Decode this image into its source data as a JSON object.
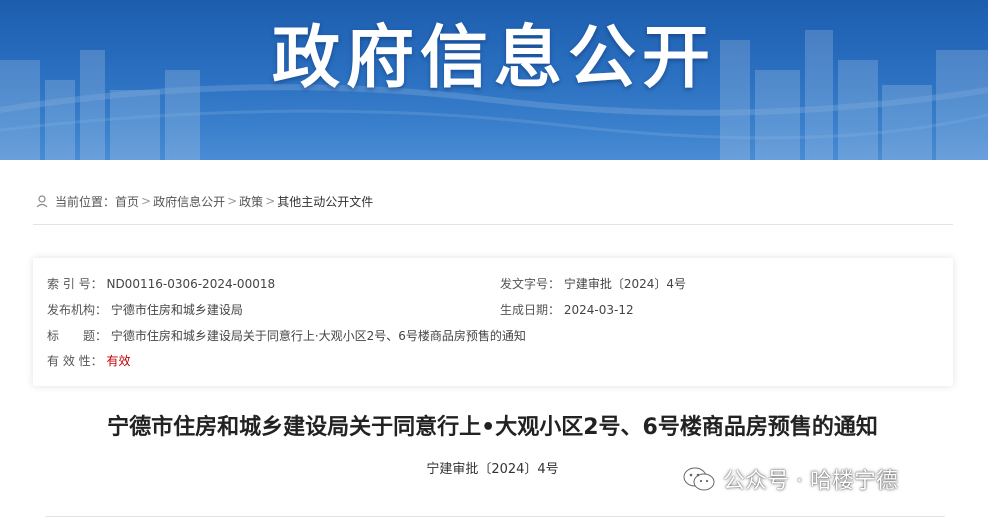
{
  "banner": {
    "title": "政府信息公开"
  },
  "breadcrumb": {
    "prefix": "当前位置：",
    "items": [
      "首页",
      "政府信息公开",
      "政策",
      "其他主动公开文件"
    ],
    "separator": ">"
  },
  "info": {
    "index_label": "索 引 号：",
    "index_value": "ND00116-0306-2024-00018",
    "doc_no_label": "发文字号：",
    "doc_no_value": "宁建审批〔2024〕4号",
    "publisher_label": "发布机构：",
    "publisher_value": "宁德市住房和城乡建设局",
    "date_label": "生成日期：",
    "date_value": "2024-03-12",
    "title_label": "标　　题：",
    "title_value": "宁德市住房和城乡建设局关于同意行上·大观小区2号、6号楼商品房预售的通知",
    "validity_label": "有 效 性：",
    "validity_value": "有效",
    "validity_color": "#c00000"
  },
  "document": {
    "title": "宁德市住房和城乡建设局关于同意行上•大观小区2号、6号楼商品房预售的通知",
    "number": "宁建审批〔2024〕4号"
  },
  "watermark": {
    "text": "公众号 · 哈楼宁德",
    "icon": "wechat-icon"
  },
  "colors": {
    "banner": "#2a6fc0",
    "accent_red": "#c00000"
  }
}
